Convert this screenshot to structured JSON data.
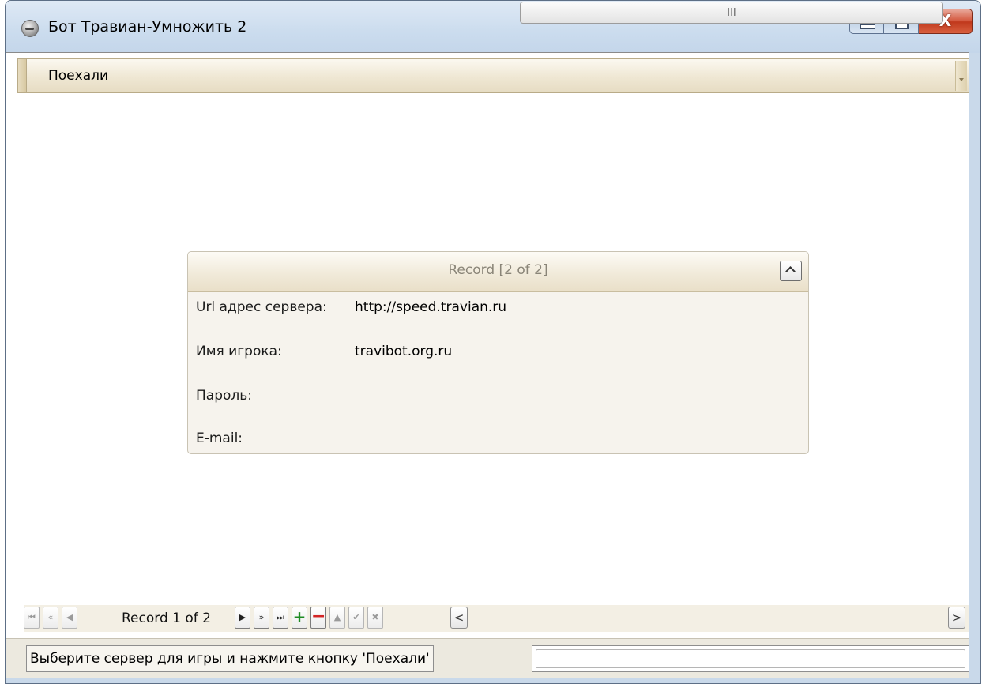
{
  "window": {
    "title": "Бот Травиан-Умножить 2",
    "icon": "app-globe-icon",
    "caption_buttons": {
      "minimize": "minimize-icon",
      "maximize": "maximize-icon",
      "close": "X"
    }
  },
  "go_bar": {
    "label": "Поехали"
  },
  "record_card": {
    "title": "Record [2 of 2]",
    "fields": [
      {
        "label": "Url адрес сервера:",
        "value": "http://speed.travian.ru"
      },
      {
        "label": "Имя игрока:",
        "value": "travibot.org.ru"
      },
      {
        "label": "Пароль:",
        "value": ""
      },
      {
        "label": "E-mail:",
        "value": ""
      }
    ]
  },
  "navigator": {
    "record_text": "Record 1 of 2",
    "buttons": {
      "first": "⏮",
      "prev_page": "«",
      "prev": "◀",
      "next": "▶",
      "next_page": "»",
      "last": "⏭",
      "append": "+",
      "delete": "−",
      "edit": "▲",
      "post": "✔",
      "cancel": "✖"
    },
    "scroll_left": "<",
    "scroll_right": ">",
    "thumb_grip": "III"
  },
  "status_bar": {
    "message": "Выберите сервер для игры и нажмите кнопку 'Поехали'",
    "secondary": ""
  },
  "colors": {
    "title_bar": "#cbdcee",
    "close_button": "#c0381c",
    "panel_beige": "#efe7d3",
    "append_green": "#1e8b22",
    "delete_red": "#d32525"
  }
}
